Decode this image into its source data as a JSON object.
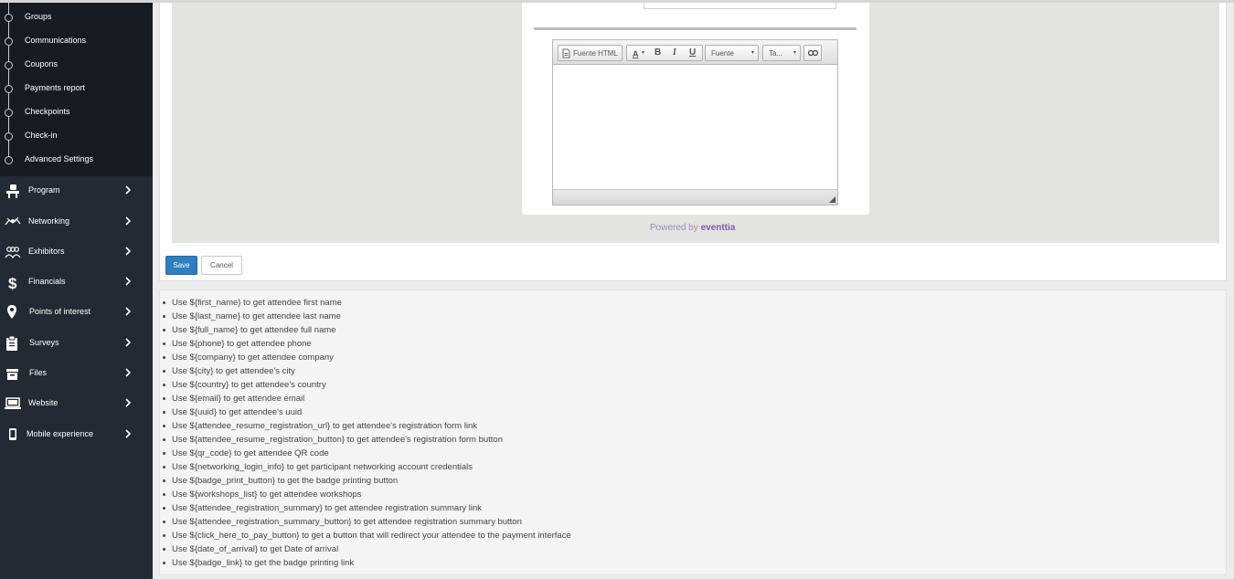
{
  "sidebar": {
    "sub_items": [
      {
        "label": "Groups"
      },
      {
        "label": "Communications"
      },
      {
        "label": "Coupons"
      },
      {
        "label": "Payments report"
      },
      {
        "label": "Checkpoints"
      },
      {
        "label": "Check-in"
      },
      {
        "label": "Advanced Settings"
      }
    ],
    "nav_items": [
      {
        "label": "Program",
        "icon": "program-icon"
      },
      {
        "label": "Networking",
        "icon": "networking-icon"
      },
      {
        "label": "Exhibitors",
        "icon": "exhibitors-icon"
      },
      {
        "label": "Financials",
        "icon": "dollar-icon"
      },
      {
        "label": "Points of interest",
        "icon": "map-pin-icon"
      },
      {
        "label": "Surveys",
        "icon": "clipboard-icon"
      },
      {
        "label": "Files",
        "icon": "box-icon"
      },
      {
        "label": "Website",
        "icon": "laptop-icon"
      },
      {
        "label": "Mobile experience",
        "icon": "mobile-icon"
      }
    ]
  },
  "editor": {
    "toolbar": {
      "source_label": "Fuente HTML",
      "text_color_label": "A",
      "bold_label": "B",
      "italic_label": "I",
      "underline_label": "U",
      "font_select": "Fuente",
      "size_select": "Ta..."
    }
  },
  "powered_by": {
    "prefix": "Powered by",
    "brand": "eventtia"
  },
  "actions": {
    "save_label": "Save",
    "cancel_label": "Cancel"
  },
  "variables_help": [
    "Use ${first_name} to get attendee first name",
    "Use ${last_name} to get attendee last name",
    "Use ${full_name} to get attendee full name",
    "Use ${phone} to get attendee phone",
    "Use ${company} to get attendee company",
    "Use ${city} to get attendee's city",
    "Use ${country} to get attendee's country",
    "Use ${email} to get attendee email",
    "Use ${uuid} to get attendee's uuid",
    "Use ${attendee_resume_registration_url} to get attendee's registration form link",
    "Use ${attendee_resume_registration_button} to get attendee's registration form button",
    "Use ${qr_code} to get attendee QR code",
    "Use ${networking_login_info} to get participant networking account credentials",
    "Use ${badge_print_button} to get the badge printing button",
    "Use ${workshops_list} to get attendee workshops",
    "Use ${attendee_registration_summary} to get attendee registration summary link",
    "Use ${attendee_registration_summary_button} to get attendee registration summary button",
    "Use ${click_here_to_pay_button} to get a button that will redirect your attendee to the payment interface",
    "Use ${date_of_arrival} to get Date of arrival",
    "Use ${badge_link} to get the badge printing link"
  ],
  "colors": {
    "sidebar_bg": "#232a33",
    "subnav_bg": "#171c22",
    "primary": "#2f7ec1",
    "brand": "#7a5ea8"
  }
}
